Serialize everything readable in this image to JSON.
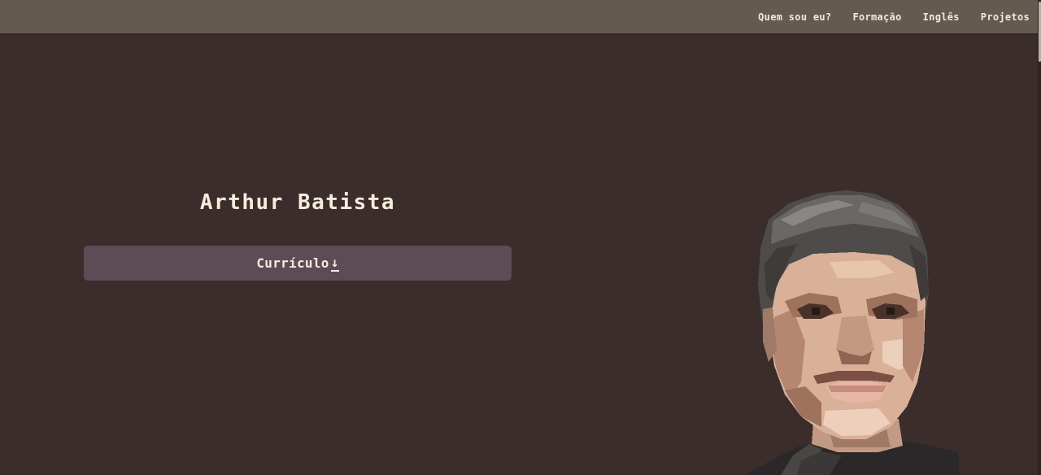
{
  "nav": {
    "items": [
      {
        "label": "Quem sou eu?"
      },
      {
        "label": "Formação"
      },
      {
        "label": "Inglês"
      },
      {
        "label": "Projetos"
      }
    ]
  },
  "hero": {
    "name": "Arthur Batista",
    "cv_button_label": "Currículo",
    "cv_icon": "↓"
  },
  "colors": {
    "background": "#3a2d2b",
    "navbar": "#645a4f",
    "button": "#5d4b56",
    "text": "#f6eddc"
  },
  "icons": {
    "cv": "download-arrow-icon"
  }
}
